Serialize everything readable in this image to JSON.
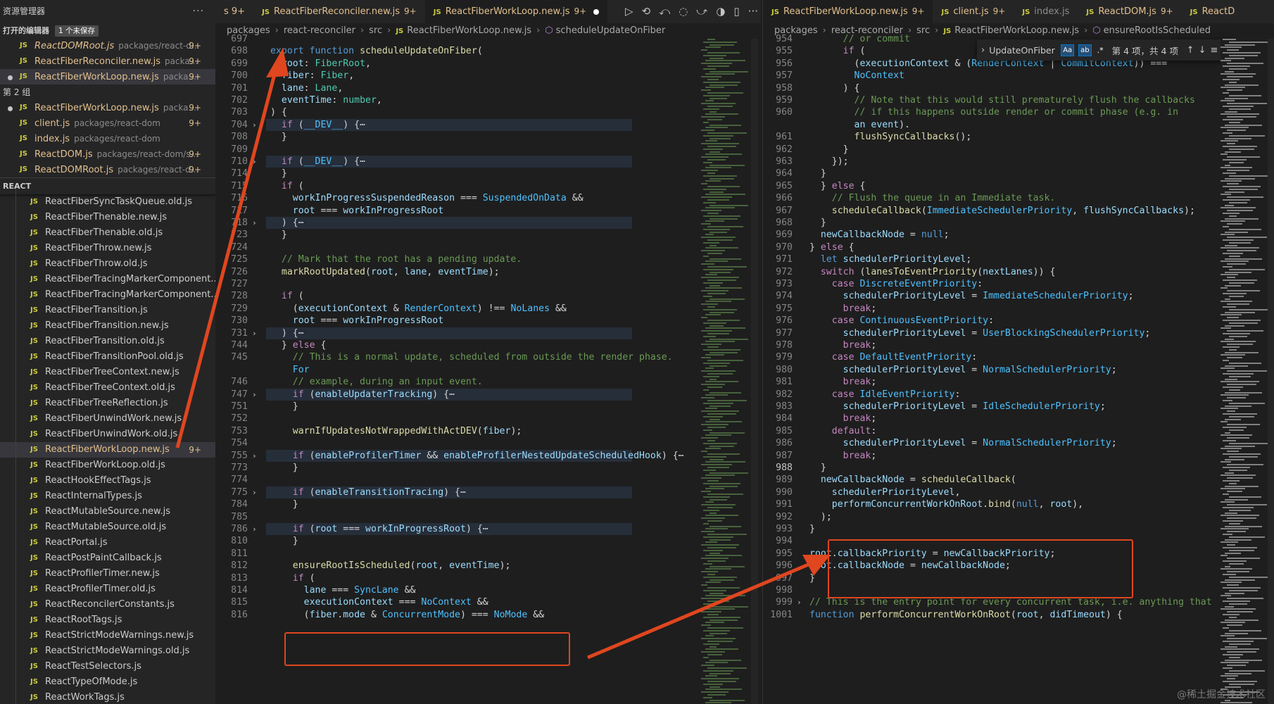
{
  "sidebar": {
    "title": "资源管理器",
    "more": "···",
    "open_editors": {
      "label": "打开的编辑器",
      "unsaved": "1 个未保存"
    },
    "group1_items": [
      {
        "name": "ReactDOMRoot.js",
        "path": "packages/react-d...",
        "count": "9+",
        "italic": true,
        "dot": false
      },
      {
        "name": "ReactFiberReconciler.new.js",
        "path": "packa...",
        "count": "9+",
        "italic": false,
        "dot": false
      },
      {
        "name": "ReactFiberWorkLoop.new.js",
        "path": "packa...",
        "count": "9+",
        "italic": false,
        "dot": true
      }
    ],
    "group2_label": "第 2 组",
    "group2_items": [
      {
        "name": "ReactFiberWorkLoop.new.js",
        "path": "packa...",
        "count": "9+",
        "dot": true
      },
      {
        "name": "client.js",
        "path": "packages/react-dom",
        "count": "9+",
        "dot": false
      },
      {
        "name": "index.js",
        "path": "packages/react-dom",
        "count": "",
        "dot": false
      },
      {
        "name": "ReactDOM.js",
        "path": "packages/react-dom/s...",
        "count": "9+",
        "dot": false
      },
      {
        "name": "ReactDOMRoot.js",
        "path": "packages/react-d...",
        "count": "9+",
        "dot": false
      }
    ],
    "tree_title": "REACT",
    "tree_items": [
      "ReactFiberSyncTaskQueue.old.js",
      "ReactFiberThenable.new.js",
      "ReactFiberThenable.old.js",
      "ReactFiberThrow.new.js",
      "ReactFiberThrow.old.js",
      "ReactFiberTracingMarkerComponent....",
      "ReactFiberTracingMarkerComponent....",
      "ReactFiberTransition.js",
      "ReactFiberTransition.new.js",
      "ReactFiberTransition.old.js",
      "ReactFiberTransitionPool.old.js",
      "ReactFiberTreeContext.new.js",
      "ReactFiberTreeContext.old.js",
      "ReactFiberTreeReflection.js",
      "ReactFiberUnwindWork.new.js",
      "ReactFiberUnwindWork.old.js",
      "ReactFiberWorkLoop.new.js",
      "ReactFiberWorkLoop.old.js",
      "ReactHookEffectTags.js",
      "ReactInternalTypes.js",
      "ReactMutableSource.new.js",
      "ReactMutableSource.old.js",
      "ReactPortal.js",
      "ReactPostPaintCallback.js",
      "ReactProfilerTimer.new.js",
      "ReactProfilerTimer.old.js",
      "ReactReconcilerConstants.js",
      "ReactRootTags.js",
      "ReactStrictModeWarnings.new.js",
      "ReactStrictModeWarnings.old.js",
      "ReactTestSelectors.js",
      "ReactTypeOfMode.js",
      "ReactWorkTags.js"
    ],
    "tree_selected_count": "9+"
  },
  "left_editor": {
    "tabs": [
      {
        "label": "s 9+",
        "js": false,
        "count": "",
        "active": false,
        "dim": false,
        "partial": true
      },
      {
        "label": "ReactFiberReconciler.new.js",
        "js": true,
        "count": "9+",
        "active": false
      },
      {
        "label": "ReactFiberWorkLoop.new.js",
        "js": true,
        "count": "9+",
        "active": true,
        "modified": true
      }
    ],
    "actions": [
      "▷",
      "⟲",
      "⤺",
      "◌",
      "⤻",
      "◑",
      "▯",
      "···"
    ],
    "breadcrumb": [
      "packages",
      "react-reconciler",
      "src",
      "ReactFiberWorkLoop.new.js",
      "scheduleUpdateOnFiber"
    ],
    "lines": [
      {
        "n": "697",
        "t": "",
        "cut": true
      },
      {
        "n": "698",
        "t": "export function scheduleUpdateOnFiber("
      },
      {
        "n": "699",
        "t": "  root: FiberRoot,"
      },
      {
        "n": "700",
        "t": "  fiber: Fiber,"
      },
      {
        "n": "701",
        "t": "  lane: Lane,"
      },
      {
        "n": "702",
        "t": "  eventTime: number,"
      },
      {
        "n": "703",
        "t": ") {"
      },
      {
        "n": "704",
        "t": "  if (__DEV__) {⋯",
        "fold": true,
        "hl": true
      },
      {
        "n": "708",
        "t": "  }"
      },
      {
        "n": "709",
        "t": ""
      },
      {
        "n": "710",
        "t": "  if (__DEV__) {⋯",
        "fold": true,
        "hl": true
      },
      {
        "n": "714",
        "t": "  }"
      },
      {
        "n": "715",
        "t": "  if ("
      },
      {
        "n": "716",
        "t": "    workInProgressSuspendedReason === SuspendedOnData &&"
      },
      {
        "n": "717",
        "t": "    root === workInProgressRoot"
      },
      {
        "n": "718",
        "t": "  ) {⋯",
        "fold": true,
        "hl": true
      },
      {
        "n": "723",
        "t": "  }"
      },
      {
        "n": "724",
        "t": ""
      },
      {
        "n": "725",
        "t": "  // Mark that the root has a pending update."
      },
      {
        "n": "726",
        "t": "  markRootUpdated(root, lane, eventTime);"
      },
      {
        "n": "727",
        "t": ""
      },
      {
        "n": "728",
        "t": "  if ("
      },
      {
        "n": "729",
        "t": "    (executionContext & RenderContext) !== NoLanes &&"
      },
      {
        "n": "730",
        "t": "    root === workInProgressRoot"
      },
      {
        "n": "731",
        "t": "  ) {⋯",
        "fold": true,
        "hl": true
      },
      {
        "n": "744",
        "t": "  } else {"
      },
      {
        "n": "745",
        "t": "    // This is a normal update, scheduled from outside the render phase."
      },
      {
        "n": "",
        "t": "    For"
      },
      {
        "n": "746",
        "t": "    // example, during an input event."
      },
      {
        "n": "747",
        "t": "    if (enableUpdaterTracking) {⋯",
        "fold": true,
        "hl": true
      },
      {
        "n": "751",
        "t": "    }"
      },
      {
        "n": "752",
        "t": ""
      },
      {
        "n": "753",
        "t": "    warnIfUpdatesNotWrappedWithActDEV(fiber);"
      },
      {
        "n": "754",
        "t": ""
      },
      {
        "n": "755",
        "t": "    if (enableProfilerTimer && enableProfilerNestedUpdateScheduledHook) {⋯",
        "fold": true,
        "hl": true
      },
      {
        "n": "773",
        "t": "    }"
      },
      {
        "n": "774",
        "t": ""
      },
      {
        "n": "775",
        "t": "    if (enableTransitionTracing) {⋯",
        "fold": true,
        "hl": true
      },
      {
        "n": "784",
        "t": "    }"
      },
      {
        "n": "785",
        "t": ""
      },
      {
        "n": "786",
        "t": "    if (root === workInProgressRoot) {⋯",
        "fold": true,
        "hl": true
      },
      {
        "n": "810",
        "t": "    }"
      },
      {
        "n": "811",
        "t": ""
      },
      {
        "n": "812",
        "t": "    ensureRootIsScheduled(root, eventTime);"
      },
      {
        "n": "813",
        "t": "    if ("
      },
      {
        "n": "814",
        "t": "      lane === SyncLane &&"
      },
      {
        "n": "815",
        "t": "      executionContext === NoContext &&"
      },
      {
        "n": "816",
        "t": "      (fiber.mode & ConcurrentMode) === NoMode &&"
      }
    ]
  },
  "right_editor": {
    "tabs": [
      {
        "label": "ReactFiberWorkLoop.new.js",
        "js": true,
        "count": "9+",
        "active": true
      },
      {
        "label": "client.js",
        "js": true,
        "count": "9+",
        "active": false
      },
      {
        "label": "index.js",
        "js": true,
        "count": "",
        "active": false,
        "dim": true
      },
      {
        "label": "ReactDOM.js",
        "js": true,
        "count": "9+",
        "active": false
      },
      {
        "label": "ReactD",
        "js": true,
        "count": "",
        "active": false
      }
    ],
    "breadcrumb": [
      "packages",
      "react-reconciler",
      "src",
      "ReactFiberWorkLoop.new.js",
      "ensureRootIsScheduled"
    ],
    "find": {
      "query": "UpdateOnFiber",
      "match_case": "Aa",
      "whole_word": "ab",
      "regex": ".*",
      "result": "第 4 项，共 4 项"
    },
    "lines": [
      {
        "n": "954",
        "t": "      // or commit",
        "cut": true
      },
      {
        "n": "955",
        "t": "      if ("
      },
      {
        "n": "956",
        "t": "        (executionContext & (RenderContext | CommitContext)) ==="
      },
      {
        "n": "957",
        "t": "        NoContext"
      },
      {
        "n": "958",
        "t": "      ) {"
      },
      {
        "n": "959",
        "t": "        // Note that this would still prematurely flush the callbacks"
      },
      {
        "n": "960",
        "t": "        // if this happens outside render or commit phase (e.g. in"
      },
      {
        "n": "",
        "t": "        an event)."
      },
      {
        "n": "961",
        "t": "        flushSyncCallbacks();"
      },
      {
        "n": "962",
        "t": "      }"
      },
      {
        "n": "963",
        "t": "    });"
      },
      {
        "n": "964",
        "t": "  }"
      },
      {
        "n": "965",
        "t": "  } else {"
      },
      {
        "n": "966",
        "t": "    // Flush the queue in an Immediate task."
      },
      {
        "n": "967",
        "t": "    scheduleCallback(ImmediateSchedulerPriority, flushSyncCallbacks);"
      },
      {
        "n": "968",
        "t": "  }"
      },
      {
        "n": "969",
        "t": "  newCallbackNode = null;"
      },
      {
        "n": "970",
        "t": "} else {"
      },
      {
        "n": "971",
        "t": "  let schedulerPriorityLevel;"
      },
      {
        "n": "972",
        "t": "  switch (lanesToEventPriority(nextLanes)) {"
      },
      {
        "n": "973",
        "t": "    case DiscreteEventPriority:"
      },
      {
        "n": "974",
        "t": "      schedulerPriorityLevel = ImmediateSchedulerPriority;"
      },
      {
        "n": "975",
        "t": "      break;"
      },
      {
        "n": "976",
        "t": "    case ContinuousEventPriority:"
      },
      {
        "n": "977",
        "t": "      schedulerPriorityLevel = UserBlockingSchedulerPriority;"
      },
      {
        "n": "978",
        "t": "      break;"
      },
      {
        "n": "979",
        "t": "    case DefaultEventPriority:"
      },
      {
        "n": "980",
        "t": "      schedulerPriorityLevel = NormalSchedulerPriority;"
      },
      {
        "n": "981",
        "t": "      break;"
      },
      {
        "n": "982",
        "t": "    case IdleEventPriority:"
      },
      {
        "n": "983",
        "t": "      schedulerPriorityLevel = IdleSchedulerPriority;"
      },
      {
        "n": "984",
        "t": "      break;"
      },
      {
        "n": "985",
        "t": "    default:"
      },
      {
        "n": "986",
        "t": "      schedulerPriorityLevel = NormalSchedulerPriority;"
      },
      {
        "n": "987",
        "t": "      break;"
      },
      {
        "n": "988",
        "t": "  }",
        "cur": true
      },
      {
        "n": "989",
        "t": "  newCallbackNode = scheduleCallback("
      },
      {
        "n": "990",
        "t": "    schedulerPriorityLevel,"
      },
      {
        "n": "991",
        "t": "    performConcurrentWorkOnRoot.bind(null, root),"
      },
      {
        "n": "992",
        "t": "  );"
      },
      {
        "n": "993",
        "t": "}"
      },
      {
        "n": "994",
        "t": ""
      },
      {
        "n": "995",
        "t": "root.callbackPriority = newCallbackPriority;"
      },
      {
        "n": "996",
        "t": "root.callbackNode = newCallbackNode;"
      },
      {
        "n": "997",
        "t": "}"
      },
      {
        "n": "998",
        "t": ""
      },
      {
        "n": "999",
        "t": "// This is the entry point for every concurrent task, i.e. anything that",
        "fold": true
      },
      {
        "n": "1001",
        "t": "function performConcurrentWorkOnRoot(root, didTimeout) {"
      }
    ]
  },
  "watermark": "@稀土掘金技术社区",
  "colors": {
    "annotation": "#e0461f",
    "modified_file": "#e2c08d",
    "js_icon": "#cbcb41"
  }
}
